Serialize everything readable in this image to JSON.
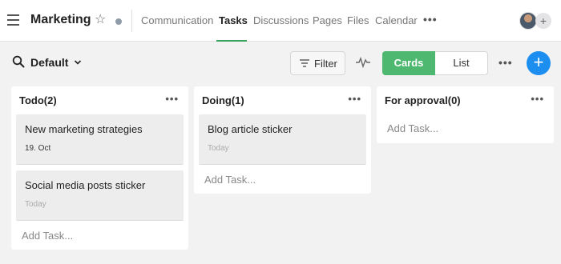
{
  "header": {
    "title": "Marketing",
    "tabs": [
      {
        "label": "Communication",
        "active": false
      },
      {
        "label": "Tasks",
        "active": true
      },
      {
        "label": "Discussions",
        "active": false
      },
      {
        "label": "Pages",
        "active": false
      },
      {
        "label": "Files",
        "active": false
      },
      {
        "label": "Calendar",
        "active": false
      }
    ],
    "more": "•••",
    "icons": [
      "hamburger-icon",
      "star-icon",
      "status-dot",
      "avatar",
      "add-member-icon"
    ],
    "add_member": "+"
  },
  "toolbar": {
    "view_label": "Default",
    "filter_label": "Filter",
    "view_modes": [
      "Cards",
      "List"
    ],
    "active_view_mode": "Cards",
    "more": "•••",
    "add": "+"
  },
  "columns": [
    {
      "title": "Todo(2)",
      "cards": [
        {
          "title": "New marketing strategies",
          "date": "19. Oct"
        },
        {
          "title": "Social media posts sticker",
          "date": "Today"
        }
      ],
      "add_task": "Add Task..."
    },
    {
      "title": "Doing(1)",
      "cards": [
        {
          "title": "Blog article sticker",
          "date": "Today"
        }
      ],
      "add_task": "Add Task..."
    },
    {
      "title": "For approval(0)",
      "cards": [],
      "add_task": "Add Task..."
    }
  ],
  "colors": {
    "accent_green": "#4eb870",
    "add_button_blue": "#1c8ef0",
    "background": "#f2f2f3"
  }
}
